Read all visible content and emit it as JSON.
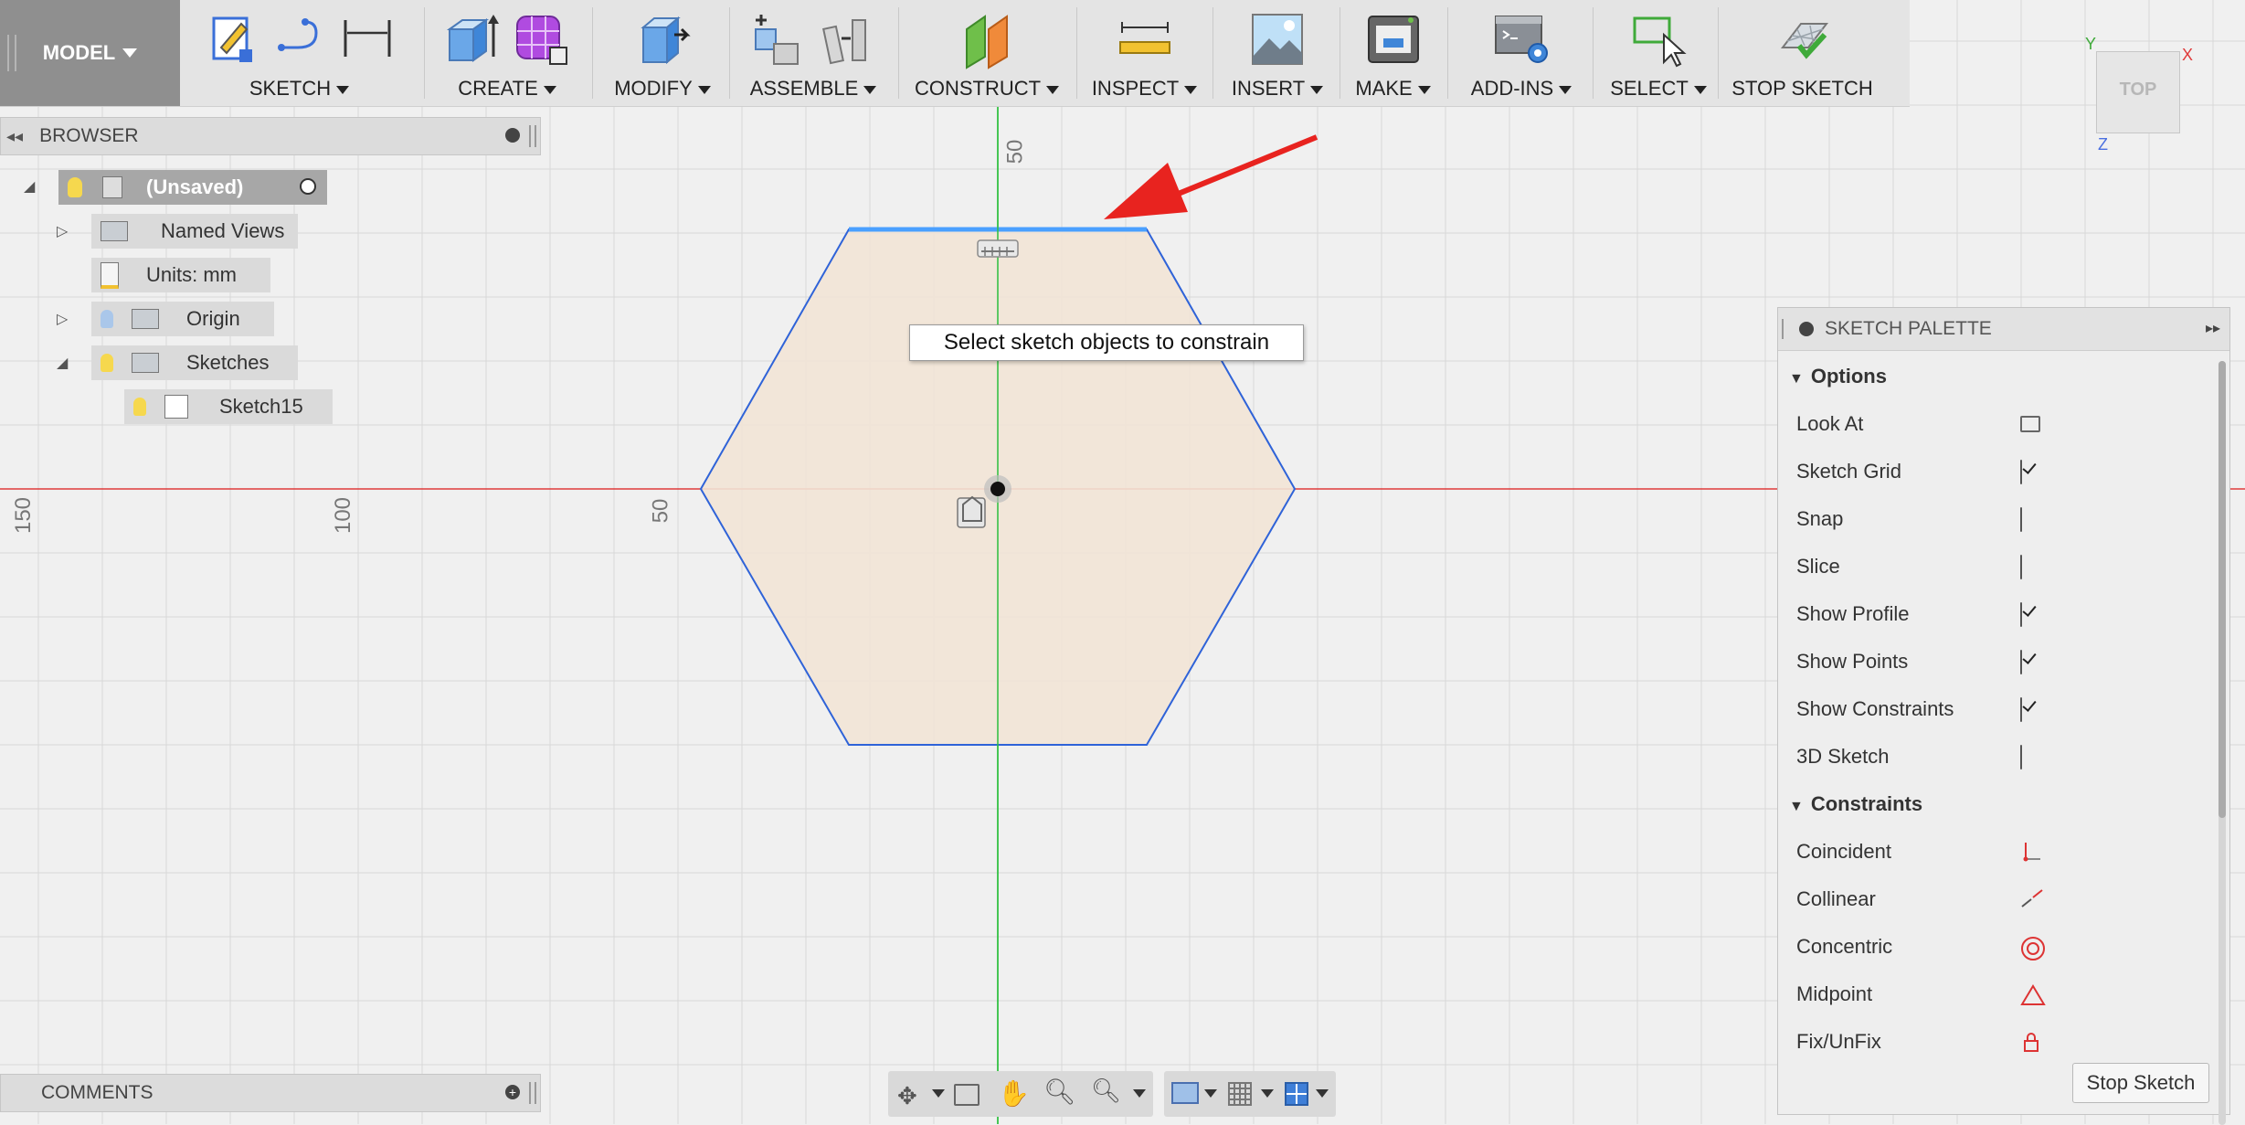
{
  "toolbar": {
    "model_label": "MODEL",
    "groups": [
      {
        "label": "SKETCH",
        "icons": [
          "create-sketch-icon",
          "arc-icon",
          "dimension-icon"
        ]
      },
      {
        "label": "CREATE",
        "icons": [
          "extrude-icon",
          "form-icon"
        ]
      },
      {
        "label": "MODIFY",
        "icons": [
          "press-pull-icon"
        ]
      },
      {
        "label": "ASSEMBLE",
        "icons": [
          "new-component-icon",
          "joint-icon"
        ]
      },
      {
        "label": "CONSTRUCT",
        "icons": [
          "offset-plane-icon"
        ]
      },
      {
        "label": "INSPECT",
        "icons": [
          "measure-icon"
        ]
      },
      {
        "label": "INSERT",
        "icons": [
          "insert-image-icon"
        ]
      },
      {
        "label": "MAKE",
        "icons": [
          "3d-print-icon"
        ]
      },
      {
        "label": "ADD-INS",
        "icons": [
          "scripts-icon"
        ]
      },
      {
        "label": "SELECT",
        "icons": [
          "select-icon"
        ]
      }
    ],
    "stop_sketch_label": "STOP SKETCH"
  },
  "browser": {
    "title": "BROWSER",
    "root_label": "(Unsaved)",
    "items": [
      {
        "label": "Named Views"
      },
      {
        "label": "Units: mm"
      },
      {
        "label": "Origin"
      },
      {
        "label": "Sketches"
      },
      {
        "label": "Sketch15"
      }
    ]
  },
  "comments": {
    "title": "COMMENTS"
  },
  "viewport": {
    "tooltip": "Select sketch objects to constrain",
    "ruler_labels": [
      "150",
      "100",
      "50",
      "50"
    ],
    "viewcube_label": "TOP",
    "axis_labels": {
      "x": "X",
      "y": "Y",
      "z": "Z"
    }
  },
  "palette": {
    "title": "SKETCH PALETTE",
    "options_label": "Options",
    "options": [
      {
        "label": "Look At",
        "type": "button",
        "icon": "look-at-icon"
      },
      {
        "label": "Sketch Grid",
        "type": "checkbox",
        "checked": true
      },
      {
        "label": "Snap",
        "type": "checkbox",
        "checked": false
      },
      {
        "label": "Slice",
        "type": "checkbox",
        "checked": false
      },
      {
        "label": "Show Profile",
        "type": "checkbox",
        "checked": true
      },
      {
        "label": "Show Points",
        "type": "checkbox",
        "checked": true
      },
      {
        "label": "Show Constraints",
        "type": "checkbox",
        "checked": true
      },
      {
        "label": "3D Sketch",
        "type": "checkbox",
        "checked": false
      }
    ],
    "constraints_label": "Constraints",
    "constraints": [
      {
        "label": "Coincident",
        "icon": "coincident-icon"
      },
      {
        "label": "Collinear",
        "icon": "collinear-icon"
      },
      {
        "label": "Concentric",
        "icon": "concentric-icon"
      },
      {
        "label": "Midpoint",
        "icon": "midpoint-icon"
      },
      {
        "label": "Fix/UnFix",
        "icon": "fix-unfix-icon"
      }
    ],
    "stop_button": "Stop Sketch"
  },
  "colors": {
    "profile_fill": "#f2e4d6",
    "sketch_line": "#2f63d8",
    "selected_line": "#4aa0ff",
    "x_axis": "#e03a3a",
    "y_axis": "#2fbf3f",
    "annotation_arrow": "#e8231f",
    "grid": "#d8d8d8"
  }
}
